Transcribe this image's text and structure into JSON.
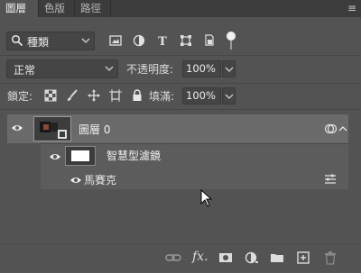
{
  "tabs": [
    {
      "label": "圖層"
    },
    {
      "label": "色版"
    },
    {
      "label": "路徑"
    }
  ],
  "filter": {
    "selected": "種類"
  },
  "blend_mode": {
    "selected": "正常"
  },
  "opacity": {
    "label": "不透明度:",
    "value": "100%"
  },
  "lock": {
    "label": "鎖定:"
  },
  "fill": {
    "label": "填滿:",
    "value": "100%"
  },
  "layers": [
    {
      "name": "圖層 0"
    }
  ],
  "smart_filters": {
    "label": "智慧型濾鏡"
  },
  "filter_item": {
    "name": "馬賽克"
  },
  "colors": {
    "panel_bg": "#535353",
    "tab_bar_bg": "#3c3c3c",
    "selected_layer_bg": "#6a6a6a",
    "field_bg": "#454545"
  },
  "icons": {
    "filter_icons": [
      "pixel-layer-filter-icon",
      "adjustment-layer-filter-icon",
      "type-layer-filter-icon",
      "shape-layer-filter-icon",
      "smart-object-filter-icon"
    ],
    "lock_icons": [
      "lock-transparent-pixels-icon",
      "lock-image-pixels-icon",
      "lock-position-icon",
      "lock-artboard-icon",
      "lock-all-icon"
    ],
    "bottom_icons": [
      "link-layers-icon",
      "fx-icon",
      "add-mask-icon",
      "new-adjustment-layer-icon",
      "new-group-icon",
      "new-layer-icon",
      "delete-layer-icon"
    ]
  }
}
